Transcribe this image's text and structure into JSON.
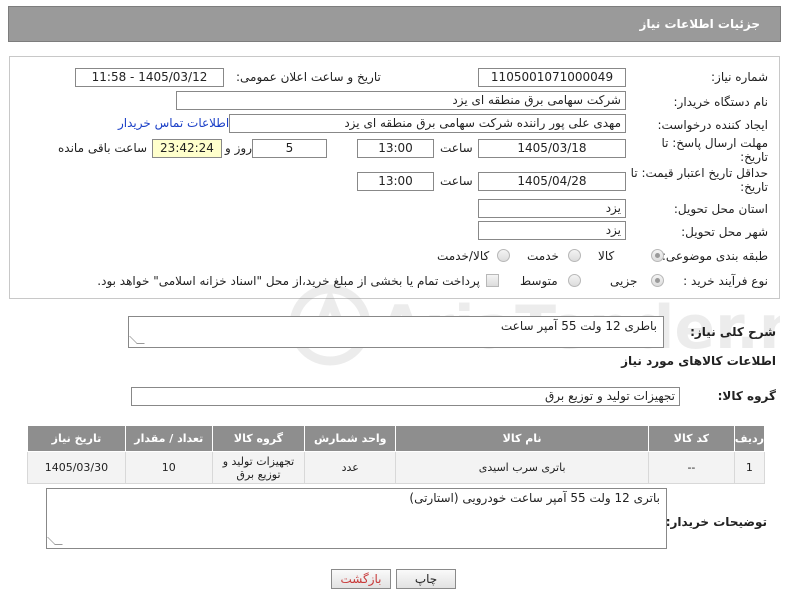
{
  "header": {
    "title": "جزئیات اطلاعات نیاز"
  },
  "form": {
    "need_number": {
      "label": "شماره نیاز:",
      "value": "1105001071000049"
    },
    "announce": {
      "label": "تاریخ و ساعت اعلان عمومی:",
      "value": "1405/03/12 - 11:58"
    },
    "buyer": {
      "label": "نام دستگاه خریدار:",
      "value": "شرکت سهامی برق منطقه ای یزد"
    },
    "requester": {
      "label": "ایجاد کننده درخواست:",
      "value": "مهدی علی پور راننده شرکت سهامی برق منطقه ای یزد",
      "contact_link": "اطلاعات تماس خریدار"
    },
    "deadline": {
      "label": "مهلت ارسال پاسخ: تا تاریخ:",
      "date": "1405/03/18",
      "time_label": "ساعت",
      "time": "13:00",
      "days": "5",
      "days_label": "روز و",
      "remaining": "23:42:24",
      "remaining_label": "ساعت باقی مانده"
    },
    "validity": {
      "label": "حداقل تاریخ اعتبار قیمت: تا تاریخ:",
      "date": "1405/04/28",
      "time_label": "ساعت",
      "time": "13:00"
    },
    "province": {
      "label": "استان محل تحویل:",
      "value": "یزد"
    },
    "city": {
      "label": "شهر محل تحویل:",
      "value": "یزد"
    },
    "category": {
      "label": "طبقه بندی موضوعی:",
      "options": [
        "کالا",
        "خدمت",
        "کالا/خدمت"
      ],
      "selected": "کالا"
    },
    "process": {
      "label": "نوع فرآیند خرید :",
      "options": [
        "جزیی",
        "متوسط"
      ],
      "payment_note": "پرداخت تمام یا بخشی از مبلغ خرید،از محل \"اسناد خزانه اسلامی\" خواهد بود."
    }
  },
  "summary": {
    "label": "شرح کلی نیاز:",
    "value": "باطری 12 ولت 55 آمپر ساعت"
  },
  "goods_title": "اطلاعات کالاهای مورد نیاز",
  "goods_group": {
    "label": "گروه کالا:",
    "value": "تجهیزات تولید و توزیع برق"
  },
  "table": {
    "headers": [
      "ردیف",
      "کد کالا",
      "نام کالا",
      "واحد شمارش",
      "گروه کالا",
      "تعداد / مقدار",
      "تاریخ نیاز"
    ],
    "rows": [
      [
        "1",
        "--",
        "باتری سرب اسیدی",
        "عدد",
        "تجهیزات تولید و توزیع برق",
        "10",
        "1405/03/30"
      ]
    ]
  },
  "buyer_notes": {
    "label": "توضیحات خریدار:",
    "value": "باتری 12 ولت 55 آمپر ساعت خودرویی (استارتی)"
  },
  "buttons": {
    "print": "چاپ",
    "back": "بازگشت"
  },
  "watermark_text": "AriaTender.net",
  "colors": {
    "header_bg": "#9a9a9a",
    "table_header_bg": "#8e8e8e",
    "link": "#1a3fc7",
    "back_button_text": "#c83a3a",
    "remaining_bg": "#ffffcc"
  }
}
